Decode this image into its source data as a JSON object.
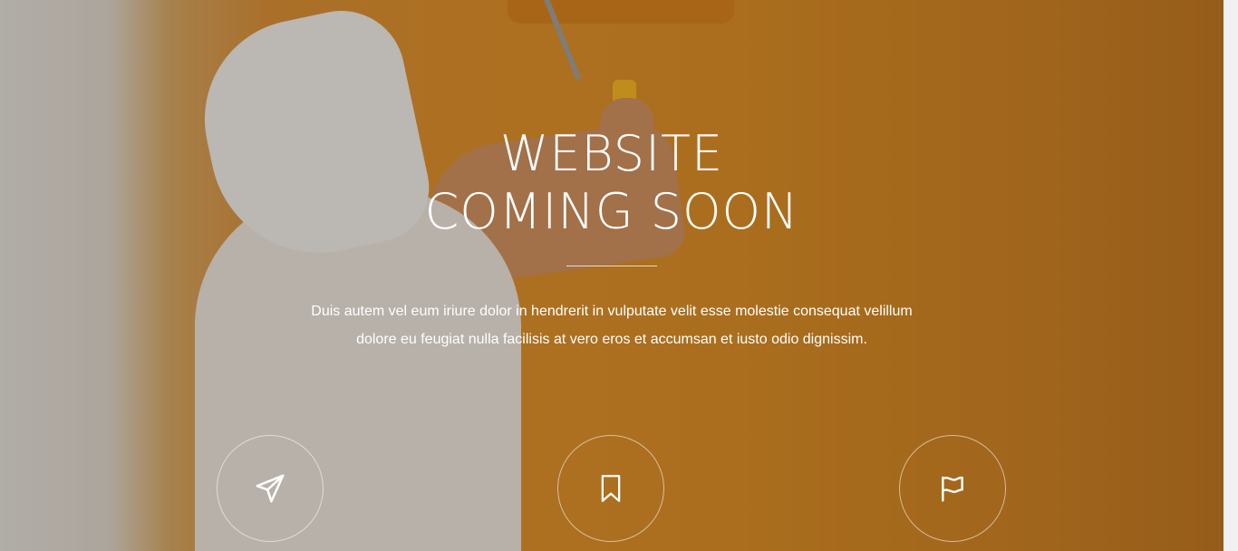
{
  "hero": {
    "title_line_1": "WEBSITE",
    "title_line_2": "COMING SOON",
    "description_line_1": "Duis autem vel eum iriure dolor in hendrerit in vulputate velit esse molestie consequat velillum",
    "description_line_2": "dolore eu feugiat nulla facilisis at vero eros et accumsan et iusto odio dignissim."
  },
  "icons": [
    {
      "name": "paper-plane-icon"
    },
    {
      "name": "bookmark-icon"
    },
    {
      "name": "flag-icon"
    }
  ],
  "colors": {
    "accent_orange": "#d98a24",
    "text": "#ffffff"
  }
}
